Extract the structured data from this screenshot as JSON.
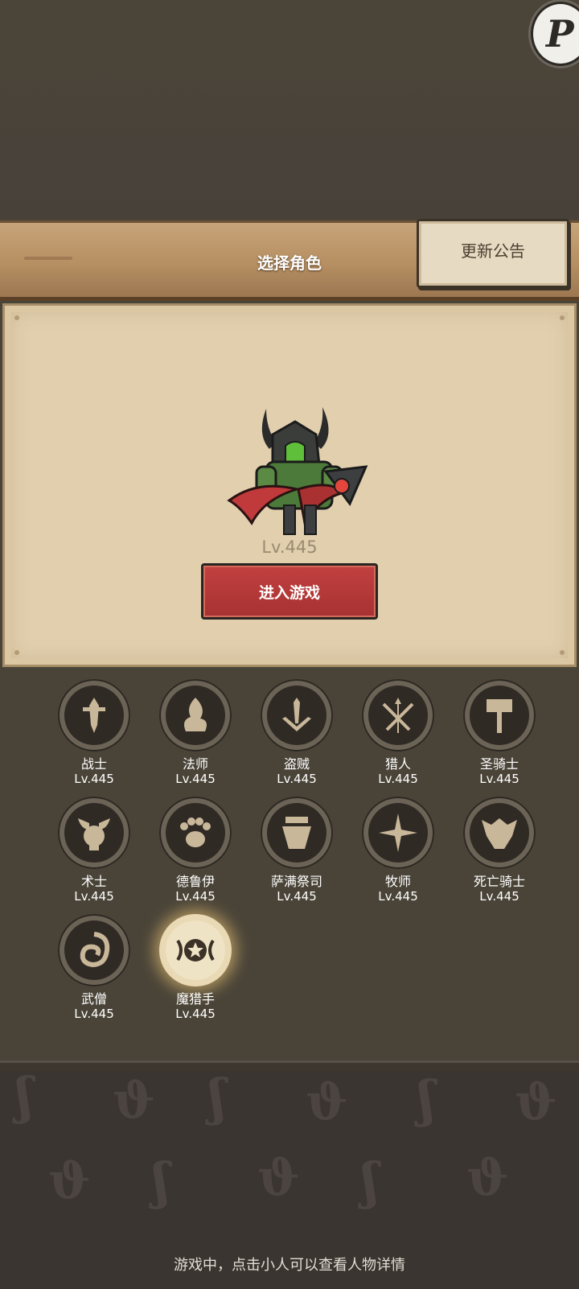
{
  "header": {
    "title": "选择角色",
    "notice_button": "更新公告",
    "corner_badge": "P"
  },
  "hero": {
    "level": "Lv.445",
    "enter_button": "进入游戏"
  },
  "classes": [
    {
      "name": "战士",
      "level": "Lv.445",
      "icon": "sword-icon"
    },
    {
      "name": "法师",
      "level": "Lv.445",
      "icon": "flame-icon"
    },
    {
      "name": "盗贼",
      "level": "Lv.445",
      "icon": "dagger-icon"
    },
    {
      "name": "猎人",
      "level": "Lv.445",
      "icon": "arrows-icon"
    },
    {
      "name": "圣骑士",
      "level": "Lv.445",
      "icon": "hammer-icon"
    },
    {
      "name": "术士",
      "level": "Lv.445",
      "icon": "skull-icon"
    },
    {
      "name": "德鲁伊",
      "level": "Lv.445",
      "icon": "paw-icon"
    },
    {
      "name": "萨满祭司",
      "level": "Lv.445",
      "icon": "totem-icon"
    },
    {
      "name": "牧师",
      "level": "Lv.445",
      "icon": "star-burst-icon"
    },
    {
      "name": "死亡骑士",
      "level": "Lv.445",
      "icon": "helm-icon"
    },
    {
      "name": "武僧",
      "level": "Lv.445",
      "icon": "swirl-icon"
    },
    {
      "name": "魔猎手",
      "level": "Lv.445",
      "icon": "star-crest-icon",
      "selected": true
    }
  ],
  "footer": {
    "hint": "游戏中，点击小人可以查看人物详情"
  },
  "colors": {
    "accent_red": "#b33636",
    "parchment": "#e1cfae",
    "wood": "#b68f62",
    "bg": "#4a4438"
  }
}
